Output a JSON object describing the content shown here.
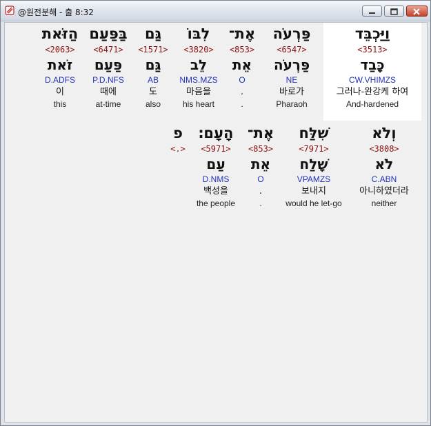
{
  "window": {
    "title": "@원전분해 - 출 8:32",
    "icon": "scroll-icon"
  },
  "controls": {
    "minimize": "minimize-icon",
    "maximize": "maximize-icon",
    "close": "close-icon"
  },
  "row1": [
    {
      "heb": "וַיַּכְבֵּד",
      "num": "<3513>",
      "heb2": "כָּבַד",
      "pars": "CW.VHIMZS",
      "kor": "그러나-완강케 하여",
      "eng": "And-hardened"
    },
    {
      "heb": "פַּרְעֹה",
      "num": "<6547>",
      "heb2": "פַּרְעֹה",
      "pars": "NE",
      "kor": "바로가",
      "eng": "Pharaoh"
    },
    {
      "heb": "אֶת־",
      "num": "<853>",
      "heb2": "אֵת",
      "pars": "O",
      "kor": ".",
      "eng": "."
    },
    {
      "heb": "לִבּוֹ",
      "num": "<3820>",
      "heb2": "לֵב",
      "pars": "NMS.MZS",
      "kor": "마음을",
      "eng": "his heart"
    },
    {
      "heb": "גַּם",
      "num": "<1571>",
      "heb2": "גַּם",
      "pars": "AB",
      "kor": "도",
      "eng": "also"
    },
    {
      "heb": "בַּפַּעַם",
      "num": "<6471>",
      "heb2": "פַּעַם",
      "pars": "P.D.NFS",
      "kor": "때에",
      "eng": "at-time"
    },
    {
      "heb": "הַזֹּאת",
      "num": "<2063>",
      "heb2": "זֹאת",
      "pars": "D.ADFS",
      "kor": "이",
      "eng": "this"
    }
  ],
  "row2": [
    {
      "heb": "וְלֹא",
      "num": "<3808>",
      "heb2": "לֹא",
      "pars": "C.ABN",
      "kor": "아니하였더라",
      "eng": "neither"
    },
    {
      "heb": "שִׁלַּח",
      "num": "<7971>",
      "heb2": "שָׁלַח",
      "pars": "VPAMZS",
      "kor": "보내지",
      "eng": "would he let-go"
    },
    {
      "heb": "אֶת־",
      "num": "<853>",
      "heb2": "אֵת",
      "pars": "O",
      "kor": ".",
      "eng": "."
    },
    {
      "heb": "הָעָם׃",
      "num": "<5971>",
      "heb2": "עַם",
      "pars": "D.NMS",
      "kor": "백성을",
      "eng": "the people"
    },
    {
      "heb": "פ",
      "num": "<.>",
      "heb2": "",
      "pars": "",
      "kor": "",
      "eng": ""
    }
  ]
}
